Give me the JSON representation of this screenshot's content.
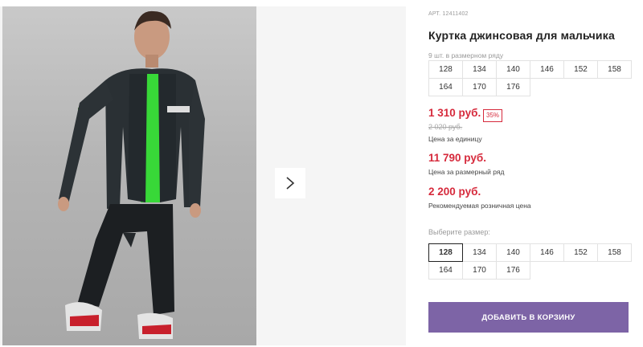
{
  "product": {
    "article": "АРТ. 12411402",
    "title": "Куртка джинсовая для мальчика",
    "row_note": "9 шт. в размерном ряду",
    "size_row": [
      "128",
      "134",
      "140",
      "146",
      "152",
      "158",
      "164",
      "170",
      "176"
    ]
  },
  "prices": {
    "unit_price": "1 310 руб.",
    "discount": "35%",
    "old_price": "2 020 руб.",
    "unit_caption": "Цена за единицу",
    "row_price": "11 790 руб.",
    "row_caption": "Цена за размерный ряд",
    "retail_price": "2 200 руб.",
    "retail_caption": "Рекомендуемая розничная цена"
  },
  "size_select": {
    "label": "Выберите размер:",
    "selected": "128",
    "options": [
      "128",
      "134",
      "140",
      "146",
      "152",
      "158",
      "164",
      "170",
      "176"
    ]
  },
  "cart": {
    "add_label": "ДОБАВИТЬ В КОРЗИНУ"
  },
  "colors": {
    "accent": "#7d64a6",
    "price_red": "#d62a3c"
  },
  "icons": {
    "next": "chevron-right-icon"
  }
}
